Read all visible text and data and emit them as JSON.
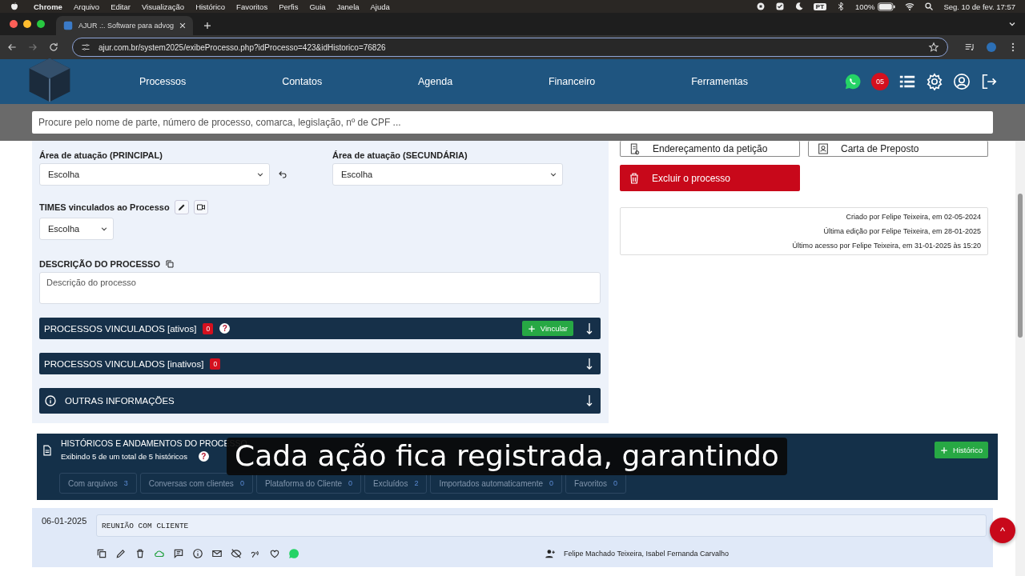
{
  "menubar": {
    "app": "Chrome",
    "items": [
      "Arquivo",
      "Editar",
      "Visualização",
      "Histórico",
      "Favoritos",
      "Perfis",
      "Guia",
      "Janela",
      "Ajuda"
    ],
    "input_source": "PT",
    "battery": "100%",
    "clock": "Seg. 10 de fev.  17:57"
  },
  "browser": {
    "tab_title": "AJUR .:. Software para advog",
    "url": "ajur.com.br/system2025/exibeProcesso.php?idProcesso=423&idHistorico=76826"
  },
  "nav": {
    "items": [
      "Processos",
      "Contatos",
      "Agenda",
      "Financeiro",
      "Ferramentas"
    ],
    "notification_count": "05"
  },
  "search": {
    "placeholder": "Procure pelo nome de parte, número de processo, comarca, legislação, nº de CPF ..."
  },
  "form": {
    "area_principal": {
      "label": "Área de atuação (PRINCIPAL)",
      "value": "Escolha"
    },
    "area_secundaria": {
      "label": "Área de atuação (SECUNDÁRIA)",
      "value": "Escolha"
    },
    "times": {
      "label": "TIMES vinculados ao Processo",
      "value": "Escolha"
    },
    "descricao": {
      "label": "DESCRIÇÃO DO PROCESSO",
      "placeholder": "Descrição do processo"
    }
  },
  "panels": [
    {
      "kind": "linked",
      "title": "PROCESSOS VINCULADOS [ativos]",
      "count": "0",
      "help": "?",
      "action": "Vincular"
    },
    {
      "kind": "linked",
      "title": "PROCESSOS VINCULADOS [inativos]",
      "count": "0"
    },
    {
      "kind": "info",
      "title": "OUTRAS INFORMAÇÕES"
    }
  ],
  "document_actions": [
    {
      "kind": "outline",
      "label": "Endereçamento da petição"
    },
    {
      "kind": "outline",
      "label": "Carta de Preposto"
    },
    {
      "kind": "danger",
      "label": "Excluir o processo"
    }
  ],
  "audit": [
    "Criado por Felipe Teixeira, em 02-05-2024",
    "Última edição por Felipe Teixeira, em 28-01-2025",
    "Último acesso por Felipe Teixeira, em 31-01-2025 às 15:20"
  ],
  "history": {
    "title": "HISTÓRICOS E ANDAMENTOS DO PROCESSO",
    "summary": "Exibindo 5 de um total de 5 históricos",
    "help": "?",
    "add": "Histórico",
    "filters": [
      {
        "label": "Com arquivos",
        "count": "3"
      },
      {
        "label": "Conversas com clientes",
        "count": "0"
      },
      {
        "label": "Plataforma do Cliente",
        "count": "0"
      },
      {
        "label": "Excluídos",
        "count": "2"
      },
      {
        "label": "Importados automaticamente",
        "count": "0"
      },
      {
        "label": "Favoritos",
        "count": "0"
      }
    ],
    "entries": [
      {
        "date": "06-01-2025",
        "text": "REUNIÃO COM CLIENTE",
        "participants": "Felipe Machado Teixeira, Isabel Fernanda Carvalho"
      }
    ]
  },
  "caption": "Cada ação fica registrada, garantindo",
  "scroll_top": "^"
}
